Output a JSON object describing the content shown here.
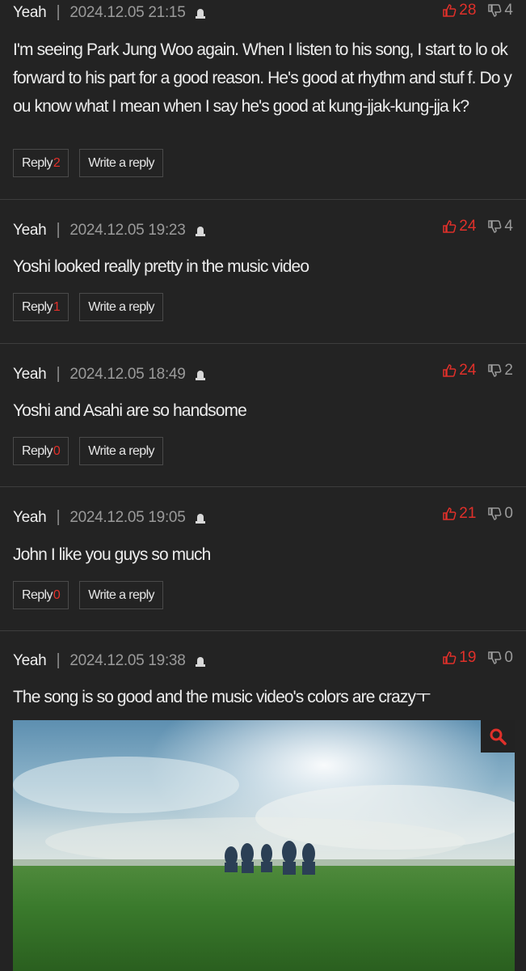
{
  "labels": {
    "reply": "Reply",
    "write_reply": "Write a reply"
  },
  "colors": {
    "accent": "#e0302a",
    "background": "#232323"
  },
  "comments": [
    {
      "author": "Yeah",
      "date": "2024.12.05 21:15",
      "likes": "28",
      "dislikes": "4",
      "text": "I'm seeing Park Jung Woo again. When I listen to his song, I start to lo ok forward to his part for a good reason. He's good at rhythm and stuf f. Do you know what I mean when I say he's good at kung-jjak-kung-jja k?",
      "reply_count": "2"
    },
    {
      "author": "Yeah",
      "date": "2024.12.05 19:23",
      "likes": "24",
      "dislikes": "4",
      "text": "Yoshi looked really pretty in the music video",
      "reply_count": "1"
    },
    {
      "author": "Yeah",
      "date": "2024.12.05 18:49",
      "likes": "24",
      "dislikes": "2",
      "text": "Yoshi and Asahi are so handsome",
      "reply_count": "0"
    },
    {
      "author": "Yeah",
      "date": "2024.12.05 19:05",
      "likes": "21",
      "dislikes": "0",
      "text": "John I like you guys so much",
      "reply_count": "0"
    },
    {
      "author": "Yeah",
      "date": "2024.12.05 19:38",
      "likes": "19",
      "dislikes": "0",
      "text": "The song is so good and the music video's colors are crazyㅜ",
      "has_image": true
    }
  ]
}
